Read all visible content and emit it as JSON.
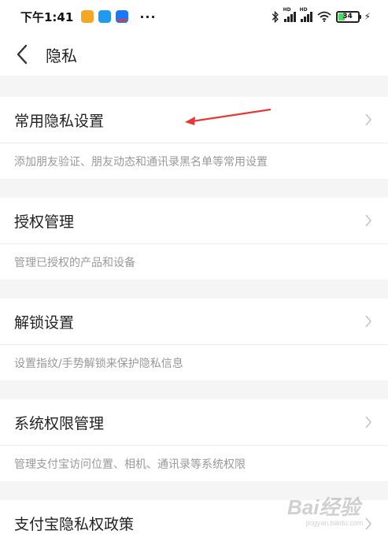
{
  "status_bar": {
    "time": "下午1:41",
    "dots": "···",
    "signal_label": "HD",
    "battery_level": "34",
    "battery_fill_percent": 34
  },
  "nav": {
    "title": "隐私"
  },
  "sections": [
    {
      "label": "常用隐私设置",
      "desc": "添加朋友验证、朋友动态和通讯录黑名单等常用设置"
    },
    {
      "label": "授权管理",
      "desc": "管理已授权的产品和设备"
    },
    {
      "label": "解锁设置",
      "desc": "设置指纹/手势解锁来保护隐私信息"
    },
    {
      "label": "系统权限管理",
      "desc": "管理支付宝访问位置、相机、通讯录等系统权限"
    },
    {
      "label": "支付宝隐私权政策"
    }
  ],
  "watermark": {
    "logo": "Bai经验",
    "sub": "jingyan.baidu.com"
  },
  "colors": {
    "annotation_arrow": "#e53935",
    "battery": "#4cd964",
    "background": "#f5f5f5"
  }
}
